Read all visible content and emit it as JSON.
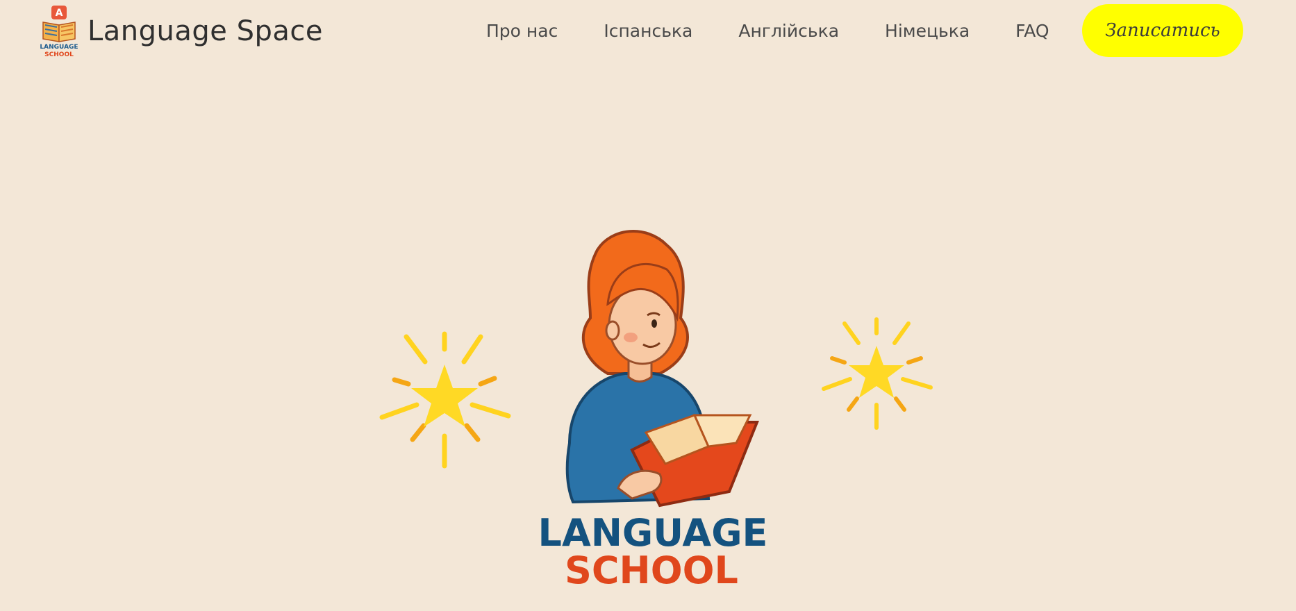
{
  "brand": {
    "name": "Language Space",
    "logo_letter": "A",
    "logo_line1": "LANGUAGE",
    "logo_line2": "SCHOOL",
    "logo_icon": "open-book-logo-icon"
  },
  "nav": {
    "items": [
      {
        "label": "Про нас"
      },
      {
        "label": "Іспанська"
      },
      {
        "label": "Англійська"
      },
      {
        "label": "Німецька"
      },
      {
        "label": "FAQ"
      }
    ],
    "cta_label": "Записатись"
  },
  "hero": {
    "title_line1": "LANGUAGE",
    "title_line2": "SCHOOL",
    "illustration": "girl-reading-book-illustration",
    "decor_left": "sparkle-star-icon",
    "decor_right": "sparkle-star-icon"
  },
  "colors": {
    "background": "#f3e7d7",
    "cta_background": "#ffff00",
    "title_blue": "#14527f",
    "title_red": "#e0471c",
    "star_yellow": "#ffd925"
  }
}
